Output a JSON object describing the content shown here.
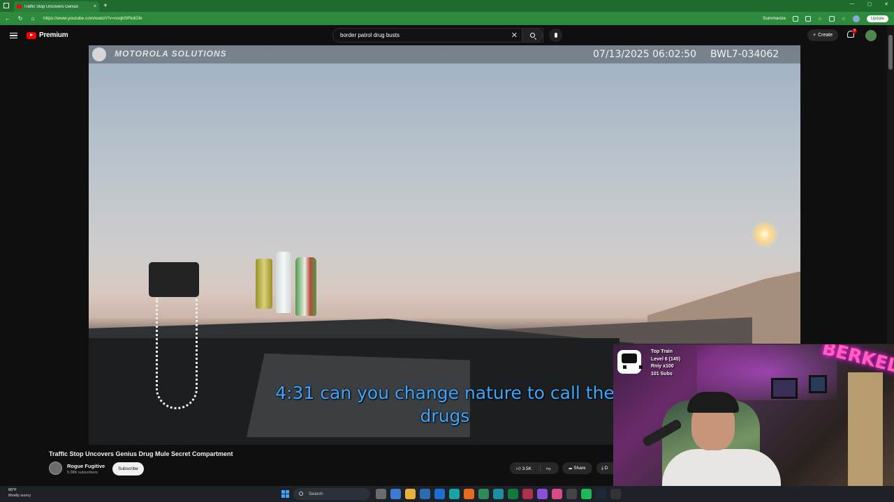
{
  "browser": {
    "tab_title": "Traffic Stop Uncovers Genius",
    "tab_close": "×",
    "new_tab": "+",
    "url": "https://www.youtube.com/watch?v=nxqbSPkdGIk",
    "summarize": "Summarize",
    "update": "Update"
  },
  "youtube": {
    "brand": "Premium",
    "search_value": "border patrol drug busts",
    "create_label": "Create",
    "notification_count": "9"
  },
  "video": {
    "watermark": "MOTOROLA SOLUTIONS",
    "timestamp": "07/13/2025 06:02:50",
    "device_id": "BWL7-034062",
    "caption_line1": "4:31 can you change nature to call the",
    "caption_line2": "drugs",
    "title": "Traffic Stop Uncovers Genius Drug Mule Secret Compartment"
  },
  "channel": {
    "name": "Rogue Fugitive",
    "subscribers": "5.98K subscribers",
    "subscribe_label": "Subscribe"
  },
  "actions": {
    "likes": "3.5K",
    "share_label": "Share",
    "download_label": "D"
  },
  "stream_overlay": {
    "line1": "Top Train",
    "line2": "Level 6  (145)",
    "line3": "Rniy x100",
    "line4": "101 Subs",
    "neon_text": "BERKEL"
  },
  "taskbar": {
    "temp": "60°F",
    "weather": "Mostly sunny",
    "search_label": "Search"
  },
  "colors": {
    "chrome_green": "#2e8b3e",
    "youtube_red": "#ff0000",
    "caption_blue": "#3ea6ff"
  }
}
